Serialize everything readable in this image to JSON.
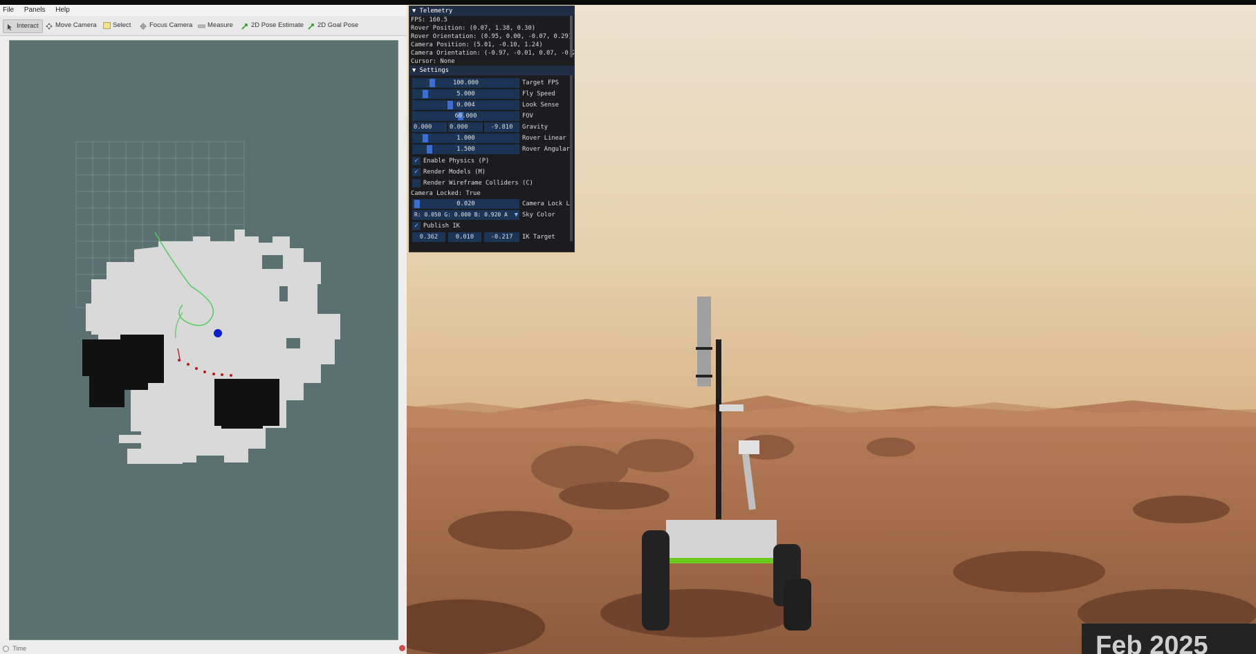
{
  "menu": [
    "File",
    "Panels",
    "Help"
  ],
  "toolbar": {
    "interact": "Interact",
    "move_camera": "Move Camera",
    "select": "Select",
    "focus_camera": "Focus Camera",
    "measure": "Measure",
    "pose_estimate": "2D Pose Estimate",
    "goal_pose": "2D Goal Pose"
  },
  "status": {
    "time": "Time"
  },
  "telemetry": {
    "title": "Telemetry",
    "lines": [
      "FPS: 160.5",
      "Rover Position: (0.07, 1.38, 0.30)",
      "Rover Orientation: (0.95, 0.00, -0.07, 0.29)",
      "Camera Position: (5.01, -0.10, 1.24)",
      "Camera Orientation: (-0.97, -0.01, 0.07, -0.2",
      "Cursor: None"
    ]
  },
  "settings": {
    "title": "Settings",
    "sliders": [
      {
        "value": "100.000",
        "label": "Target FPS",
        "level": 0.17
      },
      {
        "value": "5.000",
        "label": "Fly Speed",
        "level": 0.1
      },
      {
        "value": "0.004",
        "label": "Look Sense",
        "level": 0.35
      },
      {
        "value": "60.000",
        "label": "FOV",
        "level": 0.45
      }
    ],
    "gravity": {
      "x": "0.000",
      "y": "0.000",
      "z": "-9.810",
      "label": "Gravity"
    },
    "sliders2": [
      {
        "value": "1.000",
        "label": "Rover Linear",
        "level": 0.1
      },
      {
        "value": "1.500",
        "label": "Rover Angular",
        "level": 0.14
      }
    ],
    "checks": [
      {
        "label": "Enable Physics (P)",
        "checked": true
      },
      {
        "label": "Render Models (M)",
        "checked": true
      },
      {
        "label": "Render Wireframe Colliders (C)",
        "checked": false
      }
    ],
    "camera_locked": "Camera Locked: True",
    "camera_lock": {
      "value": "0.020",
      "label": "Camera Lock L",
      "level": 0.02
    },
    "sky": {
      "value": "R: 0.050 G: 0.000 B: 0.920 A",
      "label": "Sky Color"
    },
    "publish": {
      "label": "Publish IK",
      "checked": true
    },
    "ik": {
      "x": "0.362",
      "y": "0.010",
      "z": "-0.217",
      "label": "IK Target"
    }
  },
  "badge": "Feb 2025"
}
